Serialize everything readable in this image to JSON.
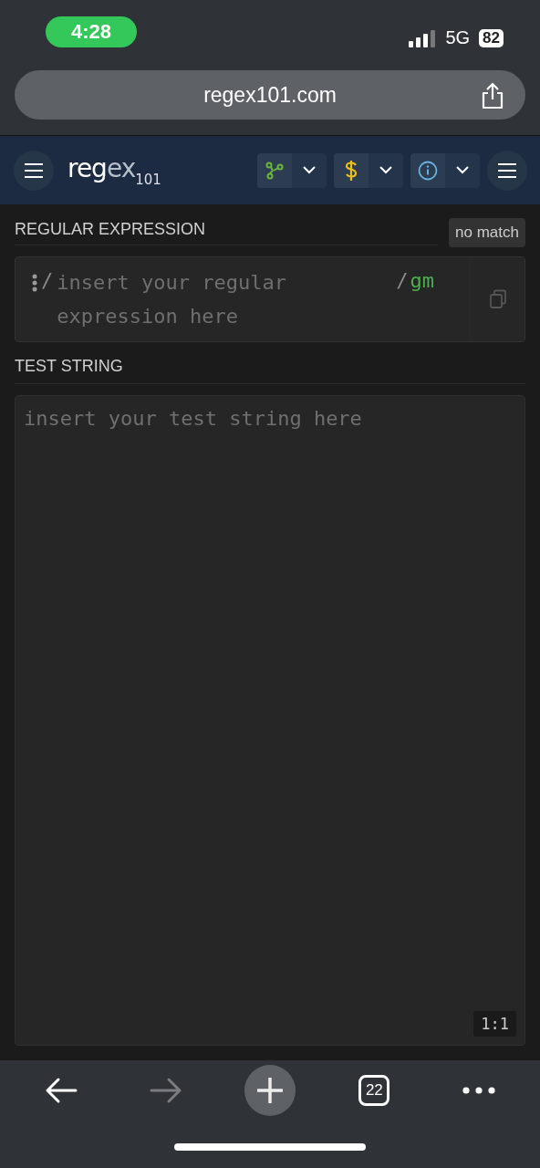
{
  "status_bar": {
    "time": "4:28",
    "network": "5G",
    "battery": "82"
  },
  "address_bar": {
    "url": "regex101.com"
  },
  "header": {
    "logo_main": "reg",
    "logo_accent": "ex",
    "logo_sub": "101",
    "tools": [
      {
        "kind": "flavor",
        "color": "#6cb33f"
      },
      {
        "kind": "function",
        "color": "#e8c21a"
      },
      {
        "kind": "info",
        "color": "#6ab0de"
      }
    ]
  },
  "regex_section": {
    "title": "REGULAR EXPRESSION",
    "match_status": "no match",
    "open_delimiter": "/",
    "placeholder": "insert your regular expression here",
    "close_delimiter": "/",
    "flags": "gm"
  },
  "test_section": {
    "title": "TEST STRING",
    "placeholder": "insert your test string here",
    "cursor_position": "1:1"
  },
  "bottom_bar": {
    "forward_disabled": true,
    "tab_count": "22"
  }
}
